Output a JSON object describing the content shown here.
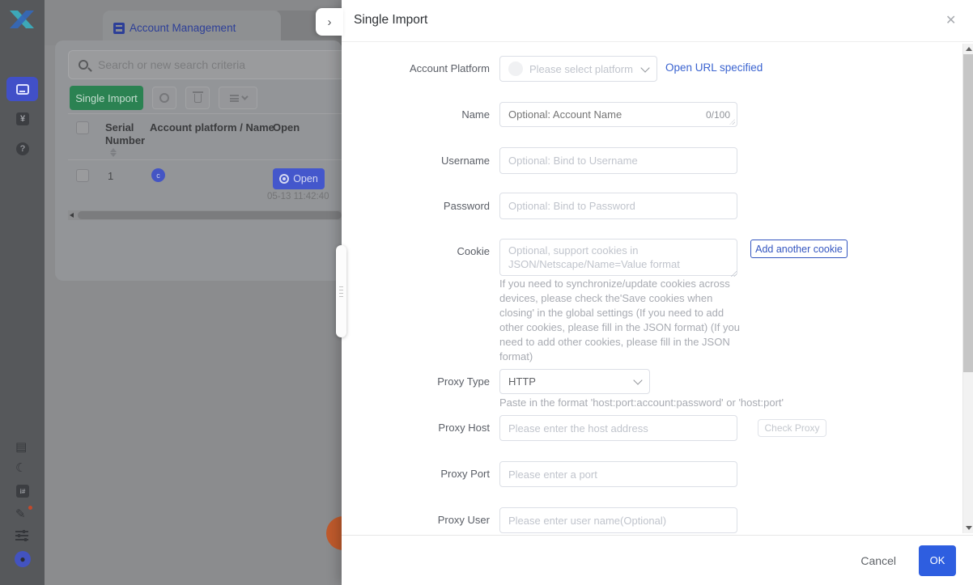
{
  "colors": {
    "accent_blue": "#2e5ee0",
    "link_blue": "#3a63d0",
    "green": "#2b8252",
    "sidebar_active": "#4150c8",
    "fab_orange": "#bf5a2c"
  },
  "icons": {
    "expand_chevron": "›",
    "close": "✕",
    "yuan": "¥",
    "question": "?",
    "moon": "☾",
    "pen": "✎",
    "doc": "▤",
    "kbd_label": "i#"
  },
  "background": {
    "tab_title": "Account Management",
    "search_placeholder": "Search or new search criteria",
    "toolbar": {
      "single_import_label": "Single Import"
    },
    "table": {
      "columns": {
        "serial": "Serial Number",
        "platform": "Account platform / Name",
        "open": "Open"
      },
      "row": {
        "serial": "1",
        "platform_initial": "c",
        "open_label": "Open",
        "timestamp": "05-13 11:42:40"
      }
    }
  },
  "modal": {
    "title": "Single Import",
    "fields": {
      "account_platform": {
        "label": "Account Platform",
        "placeholder": "Please select platform",
        "link": "Open URL specified"
      },
      "name": {
        "label": "Name",
        "placeholder": "Optional: Account Name",
        "counter": "0/100"
      },
      "username": {
        "label": "Username",
        "placeholder": "Optional: Bind to Username"
      },
      "password": {
        "label": "Password",
        "placeholder": "Optional: Bind to Password"
      },
      "cookie": {
        "label": "Cookie",
        "placeholder": "Optional, support cookies in JSON/Netscape/Name=Value format",
        "button": "Add another cookie",
        "help": "If you need to synchronize/update cookies across devices, please check the'Save cookies when closing' in the global settings (If you need to add other cookies, please fill in the JSON format) (If you need to add other cookies, please fill in the JSON format)"
      },
      "proxy_type": {
        "label": "Proxy Type",
        "value": "HTTP",
        "hint": "Paste in the format 'host:port:account:password' or 'host:port'"
      },
      "proxy_host": {
        "label": "Proxy Host",
        "placeholder": "Please enter the host address",
        "check_button": "Check Proxy"
      },
      "proxy_port": {
        "label": "Proxy Port",
        "placeholder": "Please enter a port"
      },
      "proxy_user": {
        "label": "Proxy User",
        "placeholder": "Please enter user name(Optional)"
      }
    },
    "footer": {
      "cancel": "Cancel",
      "ok": "OK"
    }
  }
}
